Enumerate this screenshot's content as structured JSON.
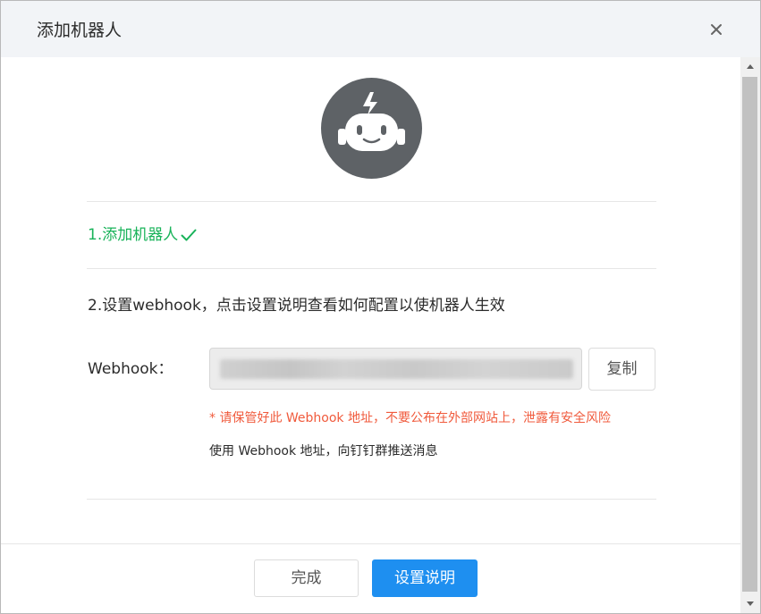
{
  "header": {
    "title": "添加机器人",
    "close_icon": "close-icon"
  },
  "avatar": {
    "icon": "robot-icon",
    "bg_color": "#5e6266"
  },
  "steps": {
    "step1": "1.添加机器人",
    "step1_icon": "check-icon",
    "step2": "2.设置webhook，点击设置说明查看如何配置以使机器人生效"
  },
  "webhook": {
    "label": "Webhook：",
    "value": "",
    "copy_label": "复制",
    "warning": "* 请保管好此 Webhook 地址，不要公布在外部网站上，泄露有安全风险",
    "usage": "使用 Webhook 地址，向钉钉群推送消息"
  },
  "footer": {
    "done_label": "完成",
    "help_label": "设置说明"
  },
  "colors": {
    "success": "#19b35a",
    "warning": "#f05a3c",
    "primary": "#1e8ff0"
  }
}
